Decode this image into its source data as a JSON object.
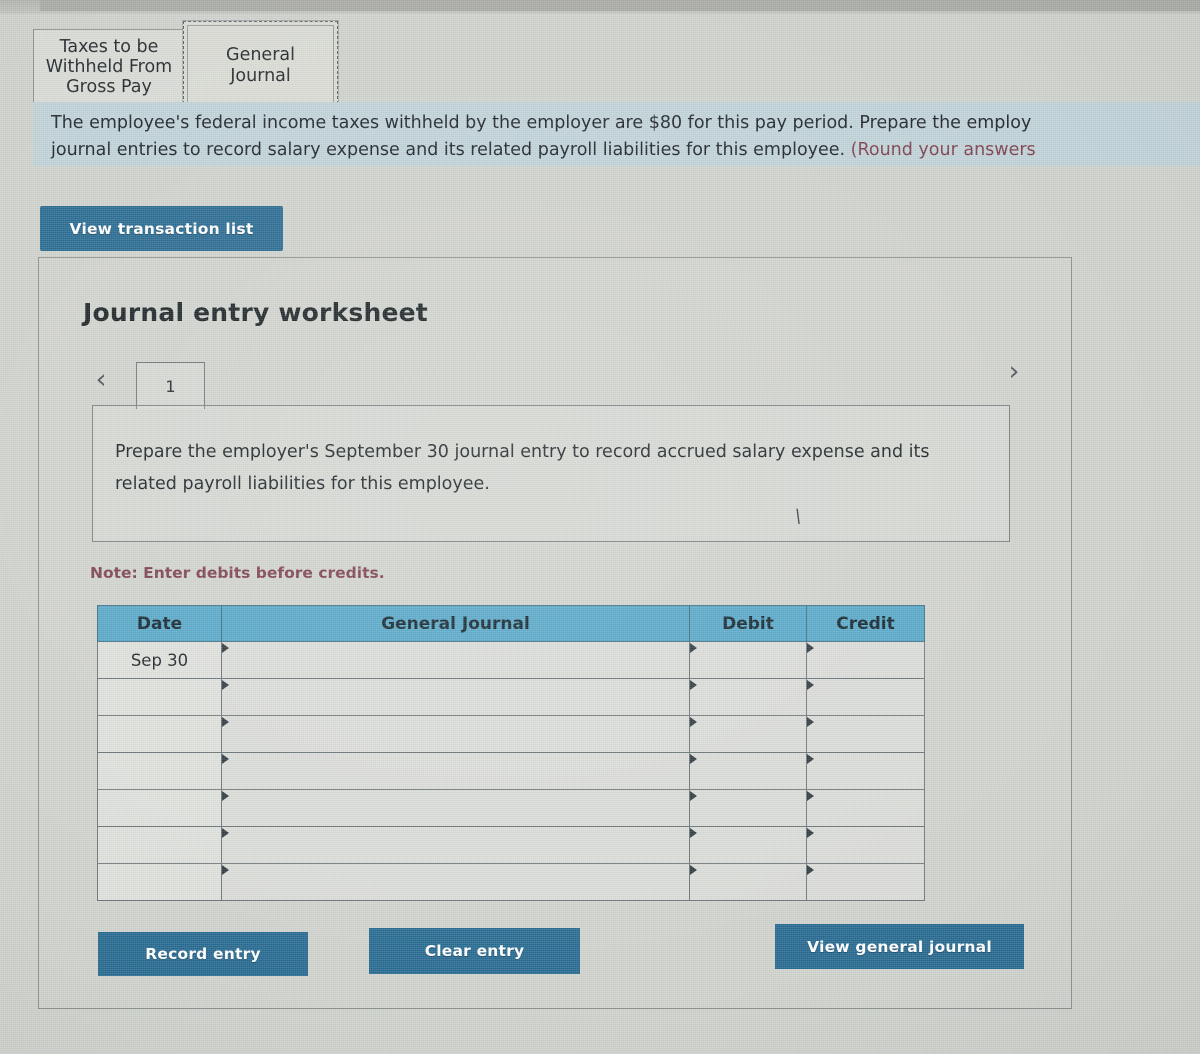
{
  "tabs": [
    {
      "id": "taxes-to-be-withheld-from-gross-pay",
      "lines": [
        "Taxes to be",
        "Withheld From",
        "Gross Pay"
      ],
      "active": false
    },
    {
      "id": "general-journal",
      "lines": [
        "General",
        "Journal"
      ],
      "active": true
    }
  ],
  "instructions": {
    "line1_a": "The employee's federal income taxes withheld by the employer are $80 for this pay period. Prepare the employ",
    "line2_a": "journal entries to record salary expense and its related payroll liabilities for this employee. ",
    "line2_b": "(Round your answers"
  },
  "buttons": {
    "view_transaction_list": "View transaction list",
    "record_entry": "Record entry",
    "clear_entry": "Clear entry",
    "view_general_journal": "View general journal"
  },
  "worksheet": {
    "title": "Journal entry worksheet",
    "page_number": "1",
    "prev_chevron": "‹",
    "next_chevron": "›",
    "prompt": "Prepare the employer's September 30 journal entry to record accrued salary expense and its related payroll liabilities for this employee.",
    "note": "Note: Enter debits before credits."
  },
  "table": {
    "headers": [
      "Date",
      "General Journal",
      "Debit",
      "Credit"
    ],
    "rows": [
      {
        "date": "Sep 30",
        "general_journal": "",
        "debit": "",
        "credit": ""
      },
      {
        "date": "",
        "general_journal": "",
        "debit": "",
        "credit": ""
      },
      {
        "date": "",
        "general_journal": "",
        "debit": "",
        "credit": ""
      },
      {
        "date": "",
        "general_journal": "",
        "debit": "",
        "credit": ""
      },
      {
        "date": "",
        "general_journal": "",
        "debit": "",
        "credit": ""
      },
      {
        "date": "",
        "general_journal": "",
        "debit": "",
        "credit": ""
      },
      {
        "date": "",
        "general_journal": "",
        "debit": "",
        "credit": ""
      }
    ]
  },
  "colors": {
    "accent_button": "#286a91",
    "table_header": "#56a7c8",
    "instruction_bg": "#c0d2d8",
    "note_text": "#7d4050",
    "page_bg": "#cfd2cc"
  }
}
